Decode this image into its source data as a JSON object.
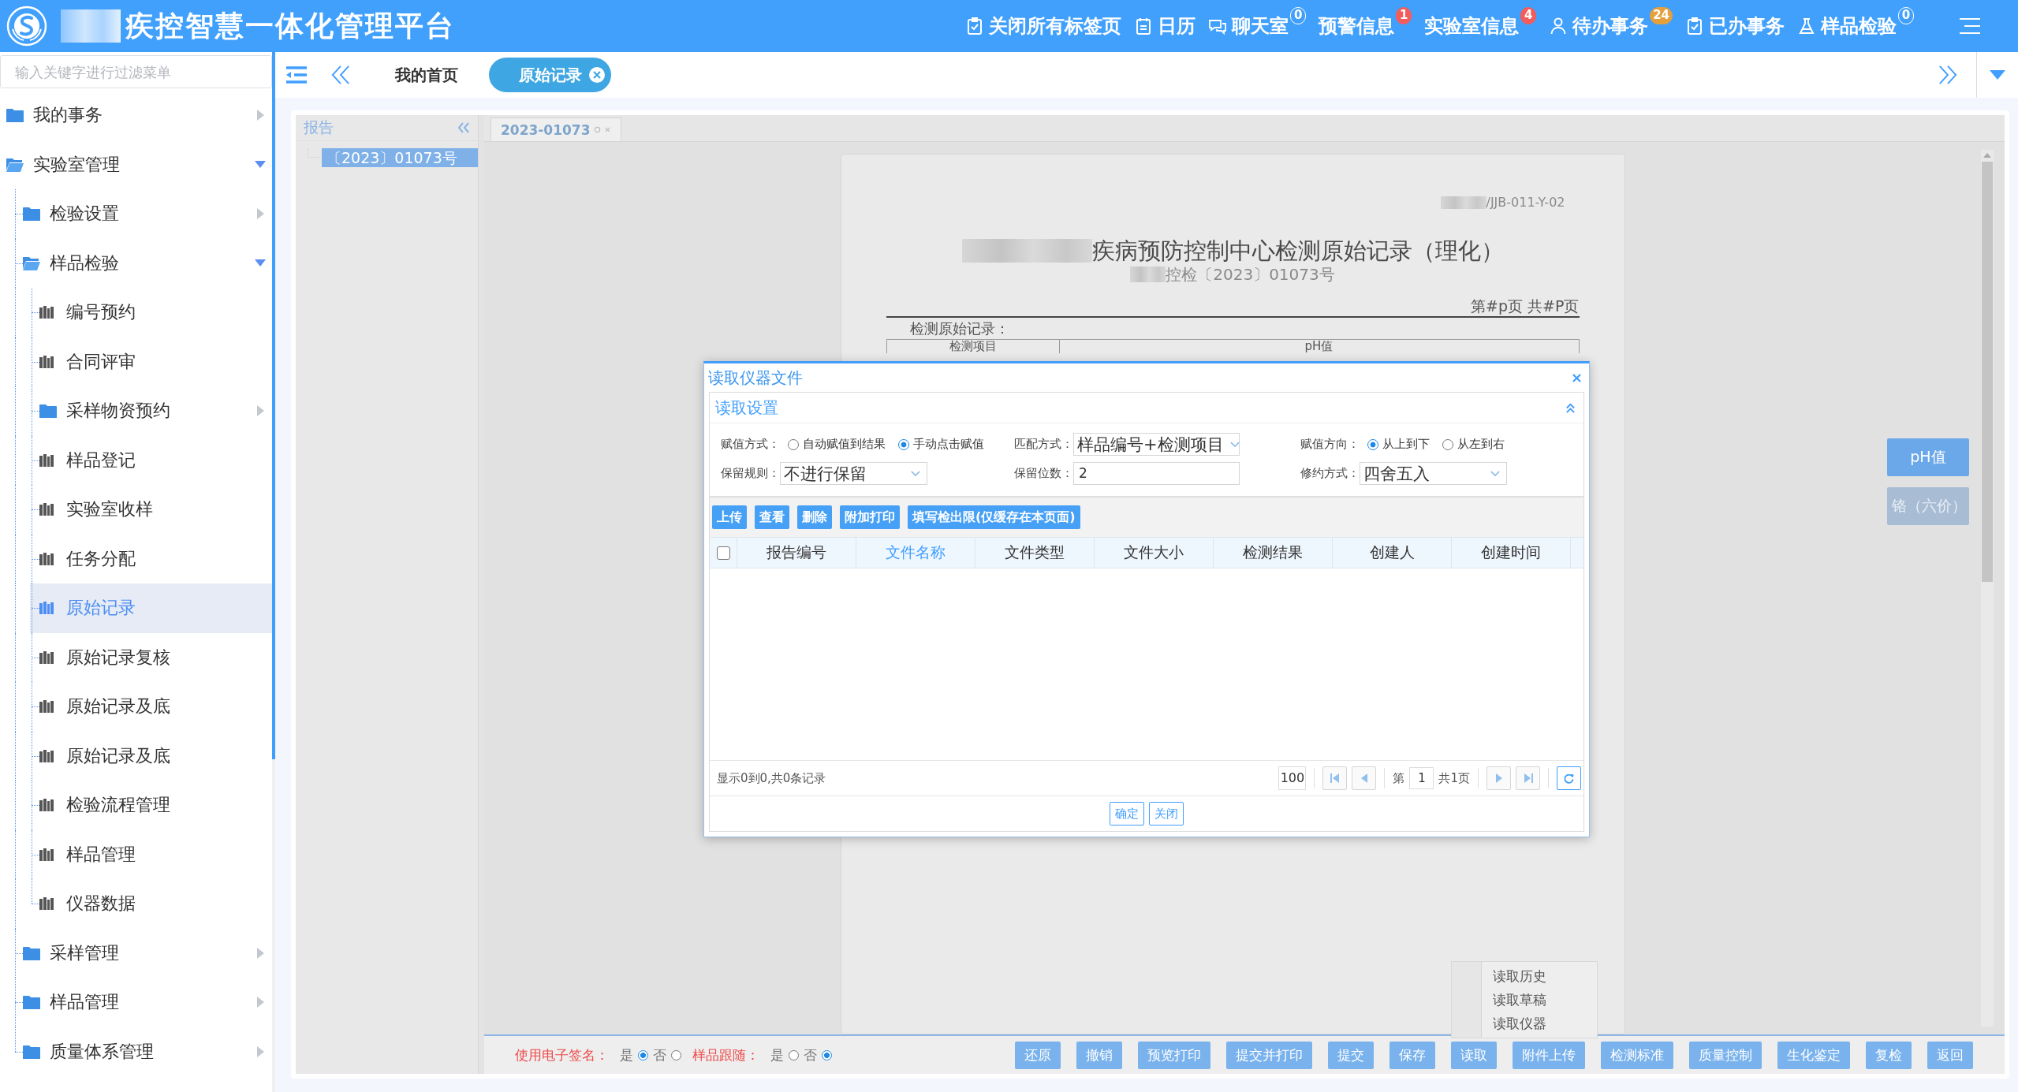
{
  "header": {
    "title": "疾控智慧一体化管理平台",
    "actions": [
      {
        "label": "关闭所有标签页"
      },
      {
        "label": "日历"
      },
      {
        "label": "聊天室",
        "badge": {
          "text": "0",
          "kind": "outline"
        }
      },
      {
        "label": "预警信息",
        "badge": {
          "text": "1",
          "kind": "filled",
          "color": "#f45c5c"
        }
      },
      {
        "label": "实验室信息",
        "badge": {
          "text": "4",
          "kind": "filled",
          "color": "#f45c5c"
        }
      },
      {
        "label": "待办事务",
        "badge": {
          "text": "24",
          "kind": "filled",
          "color": "#e5a03c"
        }
      },
      {
        "label": "已办事务"
      },
      {
        "label": "样品检验",
        "badge": {
          "text": "0",
          "kind": "outline"
        }
      }
    ]
  },
  "sidebar": {
    "filter": {
      "placeholder": "输入关键字进行过滤菜单"
    },
    "items": [
      {
        "label": "我的事务",
        "kind": "folder",
        "expanded": false,
        "selected": false
      },
      {
        "label": "实验室管理",
        "kind": "folder",
        "expanded": true,
        "selected": false,
        "children": [
          {
            "label": "检验设置",
            "kind": "folder",
            "expanded": false,
            "selected": false
          },
          {
            "label": "样品检验",
            "kind": "folder",
            "expanded": true,
            "selected": false,
            "children": [
              {
                "label": "编号预约",
                "kind": "page",
                "selected": false
              },
              {
                "label": "合同评审",
                "kind": "page",
                "selected": false
              },
              {
                "label": "采样物资预约",
                "kind": "folder",
                "expanded": false,
                "selected": false
              },
              {
                "label": "样品登记",
                "kind": "page",
                "selected": false
              },
              {
                "label": "实验室收样",
                "kind": "page",
                "selected": false
              },
              {
                "label": "任务分配",
                "kind": "page",
                "selected": false
              },
              {
                "label": "原始记录",
                "kind": "page",
                "selected": true
              },
              {
                "label": "原始记录复核",
                "kind": "page",
                "selected": false
              },
              {
                "label": "原始记录及底",
                "kind": "page",
                "selected": false
              },
              {
                "label": "原始记录及底",
                "kind": "page",
                "selected": false
              },
              {
                "label": "检验流程管理",
                "kind": "page",
                "selected": false
              },
              {
                "label": "样品管理",
                "kind": "page",
                "selected": false
              },
              {
                "label": "仪器数据",
                "kind": "page",
                "selected": false
              }
            ]
          },
          {
            "label": "采样管理",
            "kind": "folder",
            "expanded": false,
            "selected": false
          },
          {
            "label": "样品管理",
            "kind": "folder",
            "expanded": false,
            "selected": false
          },
          {
            "label": "质量体系管理",
            "kind": "folder",
            "expanded": false,
            "selected": false
          }
        ]
      }
    ]
  },
  "tabs": [
    {
      "label": "我的首页",
      "selected": false,
      "closable": false
    },
    {
      "label": "原始记录",
      "selected": true,
      "closable": true
    }
  ],
  "report_panel": {
    "title": "报告",
    "items": [
      {
        "label": "〔2023〕01073号",
        "selected": true
      }
    ]
  },
  "document_tabs": [
    {
      "label": "2023-01073",
      "selected": true
    }
  ],
  "document": {
    "code": "/JJB-011-Y-02",
    "title": "疾病预防控制中心检测原始记录（理化）",
    "number": "控检〔2023〕01073号",
    "page_label": "第#p页 共#P页",
    "section": "检测原始记录：",
    "table_header": [
      "检测项目",
      "pH值"
    ]
  },
  "item_buttons": [
    {
      "label": "pH值",
      "selected": true
    },
    {
      "label": "铬（六价）",
      "selected": false
    }
  ],
  "dialog": {
    "title": "读取仪器文件",
    "section": {
      "title": "读取设置",
      "expanded": true
    },
    "fields": [
      {
        "kind": "radio",
        "label": "赋值方式：",
        "options": [
          {
            "label": "自动赋值到结果",
            "selected": false
          },
          {
            "label": "手动点击赋值",
            "selected": true
          }
        ]
      },
      {
        "kind": "select",
        "label": "匹配方式：",
        "value": "样品编号+检测项目"
      },
      {
        "kind": "radio",
        "label": "赋值方向：",
        "options": [
          {
            "label": "从上到下",
            "selected": true
          },
          {
            "label": "从左到右",
            "selected": false
          }
        ]
      },
      {
        "kind": "select",
        "label": "保留规则：",
        "value": "不进行保留"
      },
      {
        "kind": "input",
        "label": "保留位数：",
        "value": "2"
      },
      {
        "kind": "select",
        "label": "修约方式：",
        "value": "四舍五入"
      }
    ],
    "toolbar": [
      "上传",
      "查看",
      "删除",
      "附加打印",
      "填写检出限(仅缓存在本页面)"
    ],
    "table": {
      "select_all": {
        "checked": false
      },
      "columns": [
        {
          "label": "报告编号",
          "active": false
        },
        {
          "label": "文件名称",
          "active": true
        },
        {
          "label": "文件类型",
          "active": false
        },
        {
          "label": "文件大小",
          "active": false
        },
        {
          "label": "检测结果",
          "active": false
        },
        {
          "label": "创建人",
          "active": false
        },
        {
          "label": "创建时间",
          "active": false
        }
      ]
    },
    "pager": {
      "summary": "显示0到0,共0条记录",
      "page_size": "100",
      "page_prefix": "第",
      "page": "1",
      "page_total": "共1页"
    },
    "buttons": [
      "确定",
      "关闭"
    ]
  },
  "bottom_bar": {
    "options": [
      {
        "label": "使用电子签名：",
        "choices": [
          {
            "label": "是",
            "selected": true
          },
          {
            "label": "否",
            "selected": false
          }
        ]
      },
      {
        "label": "样品跟随：",
        "choices": [
          {
            "label": "是",
            "selected": false
          },
          {
            "label": "否",
            "selected": true
          }
        ]
      }
    ],
    "buttons": [
      {
        "label": "还原"
      },
      {
        "label": "撤销"
      },
      {
        "label": "预览打印"
      },
      {
        "label": "提交并打印"
      },
      {
        "label": "提交"
      },
      {
        "label": "保存"
      },
      {
        "label": "读取",
        "menu": [
          "读取历史",
          "读取草稿",
          "读取仪器"
        ]
      },
      {
        "label": "附件上传"
      },
      {
        "label": "检测标准"
      },
      {
        "label": "质量控制"
      },
      {
        "label": "生化鉴定"
      },
      {
        "label": "复检"
      },
      {
        "label": "返回"
      }
    ]
  }
}
